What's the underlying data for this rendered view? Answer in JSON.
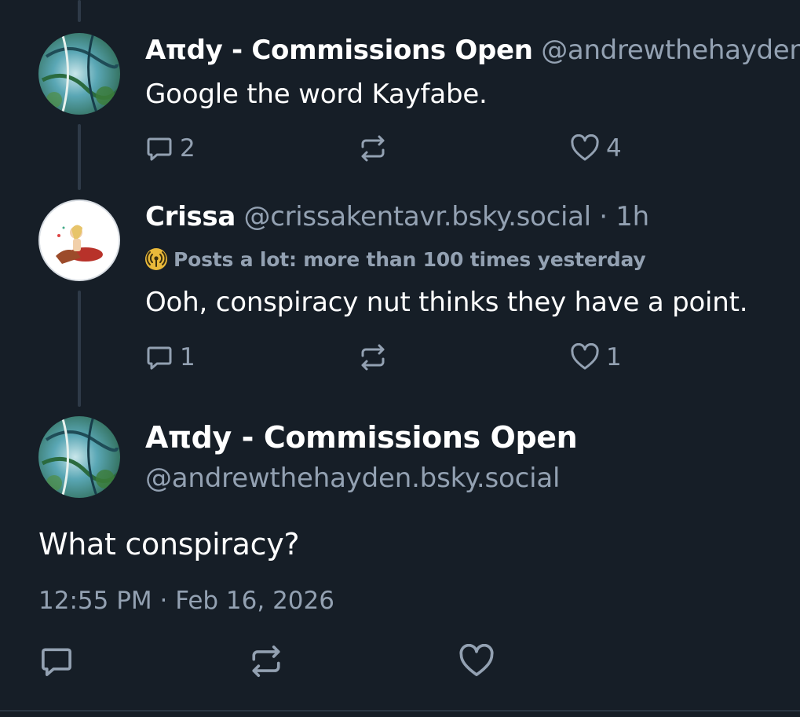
{
  "posts": [
    {
      "display_name": "Aπdy - Commissions Open",
      "handle": "@andrewthehayden.bsky.social",
      "text": "Google the word Kayfabe.",
      "replies": "2",
      "reposts": "",
      "likes": "4"
    },
    {
      "display_name": "Crissa",
      "handle": "@crissakentavr.bsky.social · 1h",
      "badge": "Posts a lot: more than 100 times yesterday",
      "text": "Ooh, conspiracy nut thinks they have a point.",
      "replies": "1",
      "reposts": "",
      "likes": "1"
    }
  ],
  "main_post": {
    "display_name": "Aπdy - Commissions Open",
    "handle": "@andrewthehayden.bsky.social",
    "text": "What conspiracy?",
    "timestamp": "12:55 PM · Feb 16, 2026"
  },
  "icons": {
    "reply": "reply-icon",
    "repost": "repost-icon",
    "like": "heart-icon",
    "badge": "broadcast-icon"
  },
  "colors": {
    "background": "#161e27",
    "muted_text": "#93a1b2",
    "thread_line": "#2e3a48",
    "badge_accent": "#e9b93a"
  }
}
